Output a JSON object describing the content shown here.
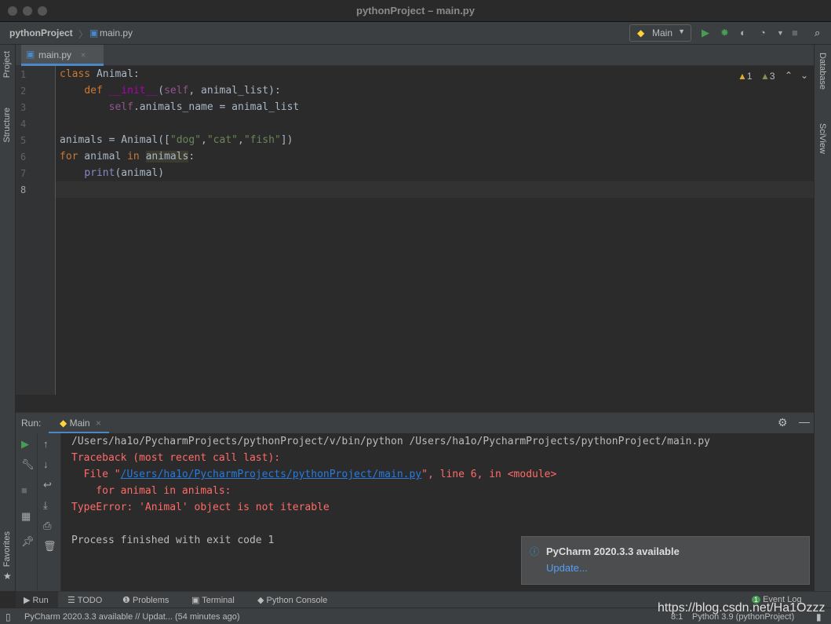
{
  "window": {
    "title": "pythonProject – main.py"
  },
  "nav": {
    "project": "pythonProject",
    "file": "main.py",
    "run_config": "Main"
  },
  "left_strip": {
    "project": "Project",
    "structure": "Structure",
    "favorites": "Favorites"
  },
  "right_strip": {
    "database": "Database",
    "sciview": "SciView"
  },
  "editor": {
    "tab": "main.py",
    "warnings": "1",
    "weak_warnings": "3",
    "line_numbers": [
      "1",
      "2",
      "3",
      "4",
      "5",
      "6",
      "7",
      "8"
    ]
  },
  "run": {
    "label": "Run:",
    "tab": "Main",
    "output": {
      "cmd": "/Users/ha1o/PycharmProjects/pythonProject/v/bin/python /Users/ha1o/PycharmProjects/pythonProject/main.py",
      "tb": "Traceback (most recent call last):",
      "file_pre": "  File \"",
      "file_link": "/Users/ha1o/PycharmProjects/pythonProject/main.py",
      "file_post": "\", line 6, in <module>",
      "src": "    for animal in animals:",
      "error": "TypeError: 'Animal' object is not iterable",
      "exit": "Process finished with exit code 1"
    }
  },
  "notification": {
    "title": "PyCharm 2020.3.3 available",
    "action": "Update..."
  },
  "bottom_tabs": {
    "run": "Run",
    "todo": "TODO",
    "problems": "Problems",
    "terminal": "Terminal",
    "console": "Python Console",
    "event_log": "Event Log",
    "event_count": "1"
  },
  "status": {
    "message": "PyCharm 2020.3.3 available // Updat... (54 minutes ago)",
    "position": "8:1",
    "interpreter": "Python 3.9 (pythonProject)"
  },
  "watermark": "https://blog.csdn.net/Ha1Ozzz",
  "colors": {
    "accent": "#4a88c7",
    "error": "#ff6b68",
    "keyword": "#cc7832",
    "string": "#6a8759",
    "run_green": "#499c54"
  }
}
